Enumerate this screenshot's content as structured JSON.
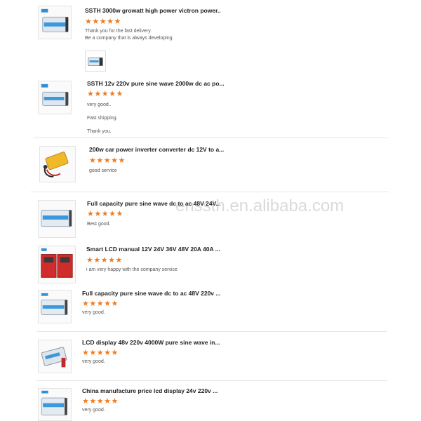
{
  "reviews": [
    {
      "product": "SSTH 3000w growatt high power victron power..",
      "stars": "★★★★★",
      "lines": [
        "Thank you for the fast delivery.",
        "Be a company that is always developing."
      ],
      "thumb_icon": "blue-inverter-icon",
      "attachment_icon": "inverter-photo-icon"
    },
    {
      "product": "SSTH 12v 220v pure sine wave 2000w dc ac po...",
      "stars": "★★★★★",
      "lines": [
        "very good..",
        "Fast shipping.",
        "Thank you."
      ],
      "thumb_icon": "blue-inverter-icon"
    },
    {
      "product": "200w car power inverter converter dc 12V to a...",
      "stars": "★★★★★",
      "lines": [
        "good service"
      ],
      "thumb_icon": "car-inverter-icon"
    },
    {
      "product": "Full capacity pure sine wave dc to ac 48V 24V...",
      "stars": "★★★★★",
      "lines": [
        "Best good."
      ],
      "thumb_icon": "blue-inverter-icon"
    },
    {
      "product": "Smart LCD manual 12V 24V 36V 48V 20A 40A ...",
      "stars": "★★★★★",
      "lines": [
        "i am very happy with the company service"
      ],
      "thumb_icon": "red-controller-icon"
    },
    {
      "product": "Full capacity pure sine wave dc to ac 48V 220v ...",
      "stars": "★★★★★",
      "lines": [
        "very good."
      ],
      "thumb_icon": "blue-inverter-icon"
    },
    {
      "product": "LCD display 48v 220v 4000W pure sine wave in...",
      "stars": "★★★★★",
      "lines": [
        "very good."
      ],
      "thumb_icon": "silver-inverter-icon"
    },
    {
      "product": "China manufacture price lcd display 24v 220v ...",
      "stars": "★★★★★",
      "lines": [
        "very good."
      ],
      "thumb_icon": "blue-inverter-icon"
    }
  ],
  "watermark": "enssth.en.alibaba.com",
  "colors": {
    "star": "#f07a1e",
    "divider": "#e6e6e6",
    "accent_blue": "#2f8fd6"
  }
}
